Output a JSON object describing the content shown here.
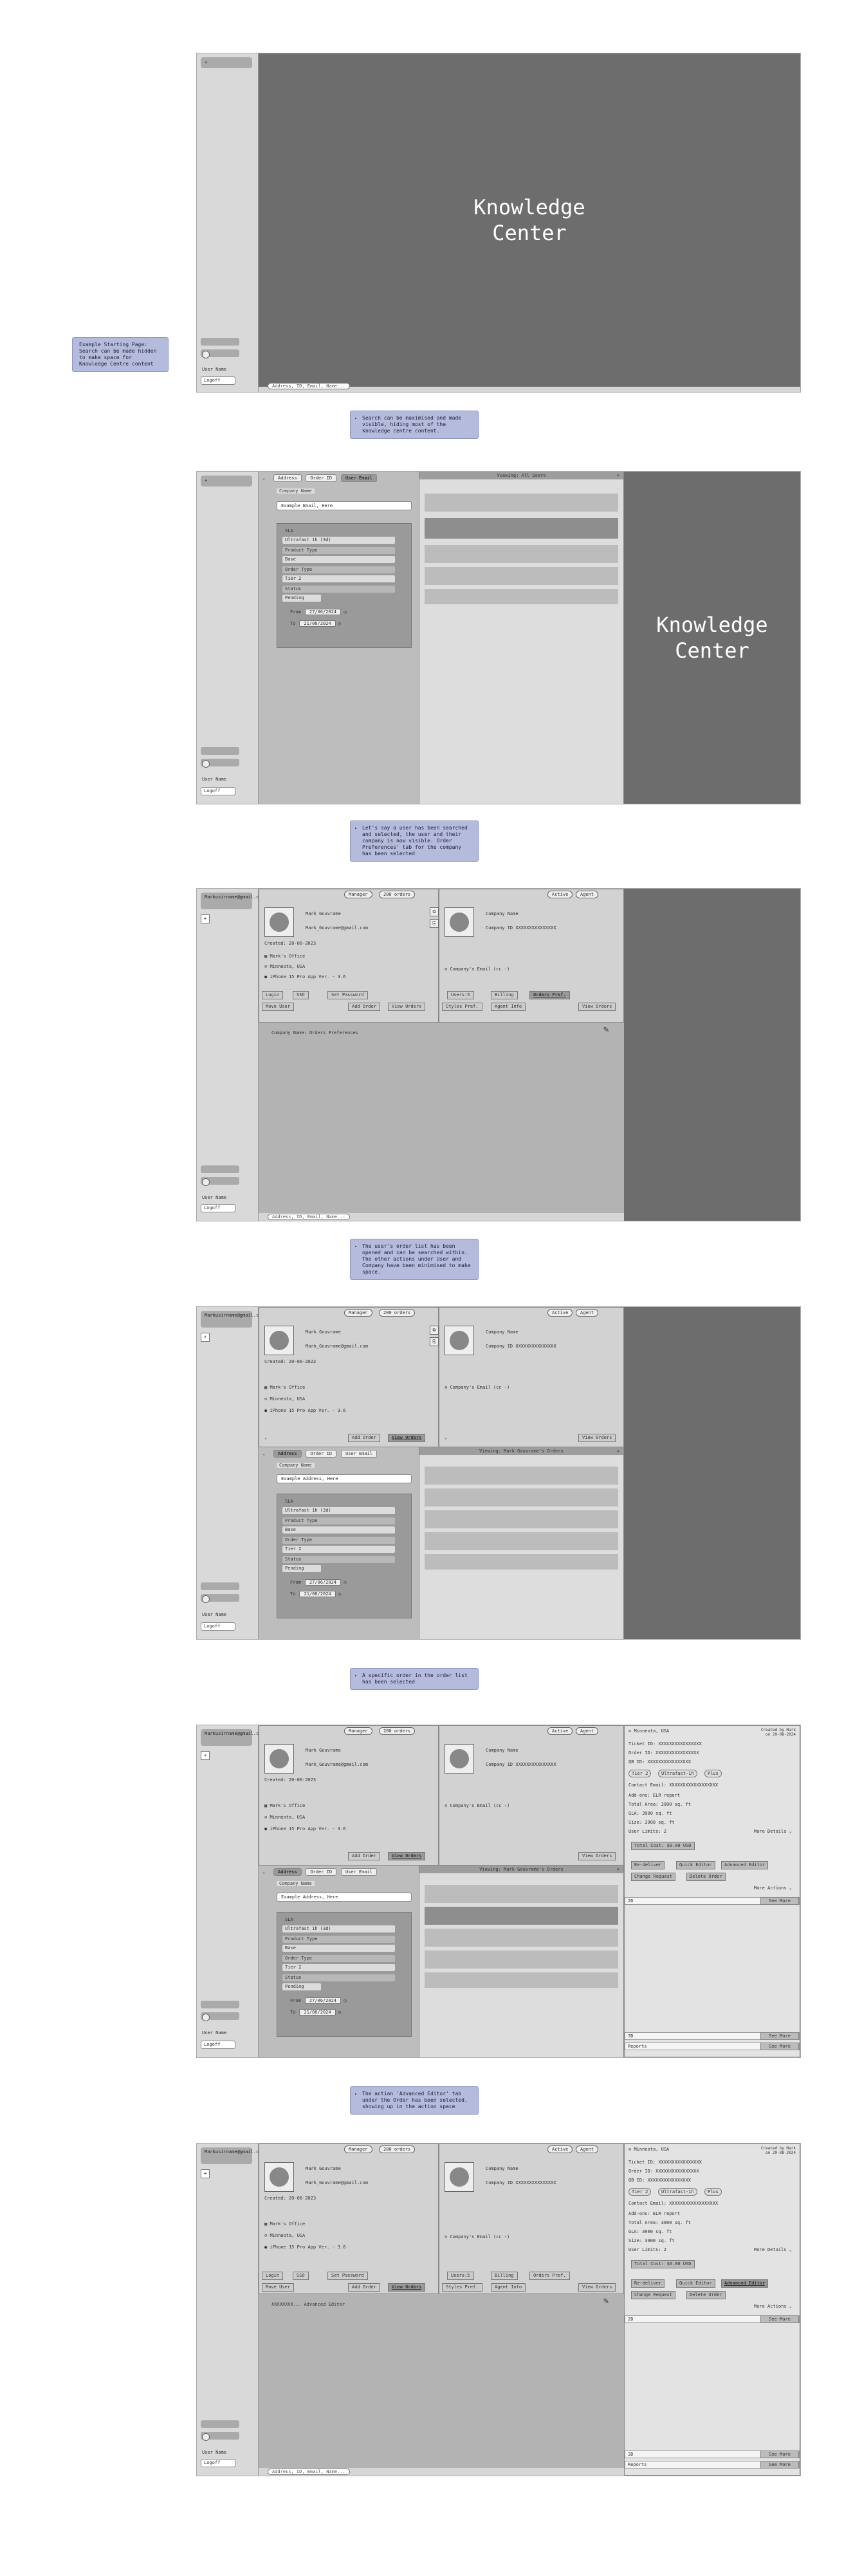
{
  "notes": {
    "starting": "Example Starting Page: Search can be made hidden to make space for Knowledge Centre content",
    "s1": "Search can be maximised and made visible, hiding most of the knowledge centre content.",
    "s2": "Let's say a user has been searched and selected, the user and their company is now visible. Order Preferences' tab for the company has been selected",
    "s3": "The user's order list has been opened and can be searched within. The other actions under User and Company have been minimised to make space.",
    "s4": "A specific order in the order list has been selected",
    "s5": "The action 'Advanced Editor' tab under the Order has been selected, showing up in the action space"
  },
  "kc": {
    "line1": "Knowledge",
    "line2": "Center"
  },
  "sidebar": {
    "user_email": "Markusirname@gmail.com",
    "add": "+",
    "user_name": "User Name",
    "logoff": "Logoff"
  },
  "search": {
    "collapsed": "Address, ID, Email, Name...",
    "tabs": [
      "Address",
      "Order ID",
      "User Email"
    ],
    "company_label": "Company Name",
    "placeholder": "Example Email, Here",
    "placeholder_addr": "Example Address, Here",
    "filters": {
      "sla_label": "SLA",
      "sla_value": "Ultrafast 1h (3d)",
      "product_label": "Product Type",
      "product_value": "Base",
      "order_label": "Order Type",
      "order_value": "Tier 2",
      "status_label": "Status",
      "status_value": "Pending",
      "from_label": "From",
      "from_value": "27/06/2024",
      "to_label": "To",
      "to_value": "21/08/2024"
    },
    "results_all": "Viewing: All Users",
    "results_orders": "Viewing: Mark Gouvrame's Orders",
    "close": "×"
  },
  "user": {
    "badge_manager": "Manager",
    "badge_orders": "200 orders",
    "name": "Mark Gouvrame",
    "email": "Mark_Gouvrame@gmail.com",
    "created": "Created: 20-06-2023",
    "office": "Mark's Office",
    "location": "Minneota, USA",
    "device": "iPhone 15 Pro",
    "app": "App Ver. - 3.6",
    "login": "Login",
    "sso": "SSO",
    "set_password": "Set Password",
    "move_user": "Move User",
    "add_order": "Add Order",
    "view_orders": "View Orders"
  },
  "company": {
    "badge_active": "Active",
    "badge_agent": "Agent",
    "name": "Company Name",
    "id": "Company ID XXXXXXXXXXXXXXX",
    "email": "Company's Email (cc -)",
    "tabs": [
      "Users:5",
      "Billing",
      "Orders Pref.",
      "Styles Pref.",
      "Agent Info",
      "View Orders"
    ]
  },
  "action": {
    "pref_title": "Company Name: Orders Preferences",
    "adv_title": "XXXXXXXX... Advanced Editor"
  },
  "order": {
    "loc": "Minneota, USA",
    "created": "Created by Mark on 29-08-2024",
    "ticket": "Ticket ID:  XXXXXXXXXXXXXXXX",
    "order_id": "Order ID:  XXXXXXXXXXXXXXXX",
    "qb": "QB ID:     XXXXXXXXXXXXXXXX",
    "chips": [
      "Tier 2",
      "Ultrafast-1h",
      "Plus"
    ],
    "contact": "Contact Email:  XXXXXXXXXXXXXXXXXX",
    "addons": "Add-ons:    ELR report",
    "area": "Total Area:  3900 sq. ft",
    "gla": "GLA:         3900 sq. ft",
    "size": "Size:        3900 sq. ft",
    "limits": "User Limits: 2",
    "more": "More Details",
    "cost": "Total Cost: $0.00 USD",
    "actions": [
      "Re-deliver",
      "Quick Editor",
      "Advanced Editor",
      "Change Request",
      "Delete Order"
    ],
    "more_actions": "More Actions",
    "bars": [
      "2D",
      "3D",
      "Reports"
    ],
    "see_more": "See More"
  }
}
